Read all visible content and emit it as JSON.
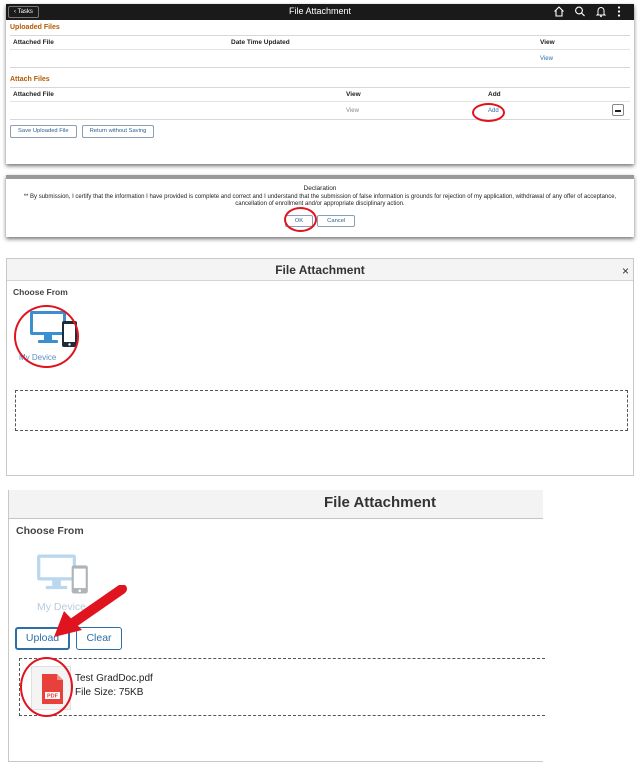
{
  "panel1": {
    "topbar": {
      "tasks_label": "Tasks",
      "title": "File Attachment"
    },
    "uploaded_section": {
      "label": "Uploaded Files",
      "headers": [
        "Attached File",
        "Date Time Updated",
        "View"
      ],
      "row_view": "View"
    },
    "attach_section": {
      "label": "Attach Files",
      "headers": [
        "Attached File",
        "View",
        "Add"
      ],
      "row_view": "View",
      "row_add": "Add"
    },
    "save_button": "Save Uploaded File",
    "return_button": "Return without Saving"
  },
  "panel2": {
    "title": "Declaration",
    "text": "** By submission, I certify that the information I have provided is complete and correct and I understand that the submission of false information is grounds for rejection of my application, withdrawal of any offer of acceptance, cancellation of enrollment and/or appropriate disciplinary action.",
    "ok": "OK",
    "cancel": "Cancel"
  },
  "panel3": {
    "title": "File Attachment",
    "close": "×",
    "choose_from": "Choose From",
    "device_label": "My Device"
  },
  "panel4": {
    "title": "File Attachment",
    "choose_from": "Choose From",
    "device_label": "My Device",
    "upload": "Upload",
    "clear": "Clear",
    "file_name": "Test GradDoc.pdf",
    "file_size": "File Size: 75KB",
    "pdf_badge": "PDF"
  },
  "icons": {
    "back": "chevron-left-icon",
    "home": "home-icon",
    "search": "search-icon",
    "bell": "bell-icon",
    "menu": "more-vertical-icon",
    "device": "computer-phone-icon",
    "pdf": "pdf-file-icon",
    "remove": "minus-icon"
  },
  "colors": {
    "section_label": "#b35a00",
    "link": "#2d6ea7",
    "highlight": "#e0141e",
    "topbar": "#1a1a1a"
  }
}
